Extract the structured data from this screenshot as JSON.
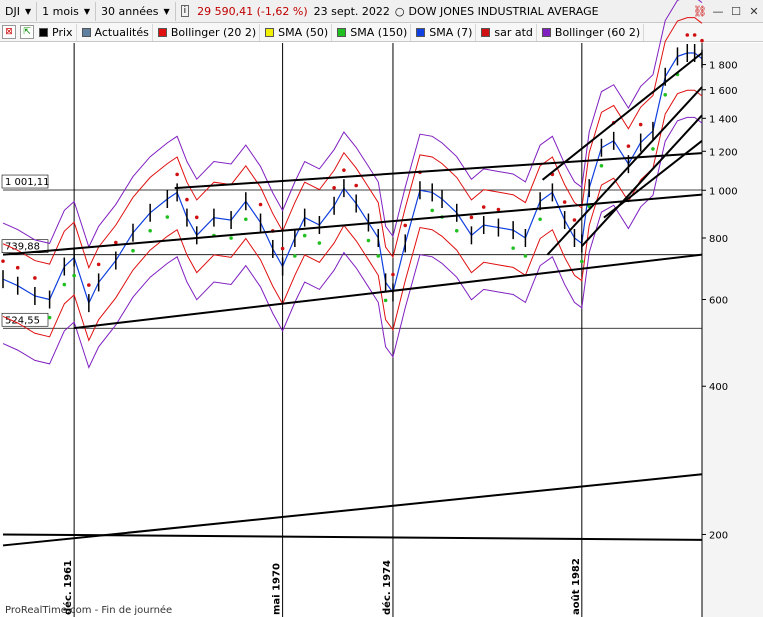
{
  "toolbar": {
    "symbol": "DJI",
    "period": "1 mois",
    "range": "30 années",
    "quote": "29 590,41 (-1,62 %)",
    "date": "23 sept. 2022",
    "instrument": "DOW JONES INDUSTRIAL AVERAGE",
    "colors": {
      "quote": "#c00000"
    }
  },
  "indicators": [
    {
      "label": "Prix",
      "color": "#000000"
    },
    {
      "label": "Actualités",
      "color": "#6080a0"
    },
    {
      "label": "Bollinger (20 2)",
      "color": "#e01010"
    },
    {
      "label": "SMA (50)",
      "color": "#f0f000"
    },
    {
      "label": "SMA (150)",
      "color": "#20c020"
    },
    {
      "label": "SMA (7)",
      "color": "#1040e0"
    },
    {
      "label": "sar atd",
      "color": "#d01010"
    },
    {
      "label": "Bollinger (60 2)",
      "color": "#8020c0"
    }
  ],
  "footer": "ProRealTime.com - Fin de journée",
  "chart_data": {
    "type": "line",
    "y_scale": "log",
    "ylim": [
      180,
      1900
    ],
    "y_ticks": [
      200,
      400,
      600,
      800,
      1000,
      1200,
      1400,
      1600,
      1800
    ],
    "y_tick_labels": [
      "200",
      "400",
      "600",
      "800",
      "1 000",
      "1 200",
      "1 400",
      "1 600",
      "1 800"
    ],
    "horizontal_levels": [
      {
        "value": 1001.11,
        "label": "1 001,11"
      },
      {
        "value": 739.88,
        "label": "739,88"
      },
      {
        "value": 524.55,
        "label": "524,55"
      }
    ],
    "x_markers": [
      {
        "label": "déc. 1961",
        "year": 1961.9
      },
      {
        "label": "mai 1970",
        "year": 1970.4
      },
      {
        "label": "déc. 1974",
        "year": 1974.9
      },
      {
        "label": "août 1982",
        "year": 1982.6
      }
    ],
    "xlim": [
      1959,
      1987.5
    ],
    "series": [
      {
        "name": "Prix",
        "color": "#000000",
        "x": [
          1959.0,
          1959.6,
          1960.3,
          1960.9,
          1961.5,
          1961.9,
          1962.5,
          1962.9,
          1963.6,
          1964.3,
          1965.0,
          1965.7,
          1966.1,
          1966.5,
          1966.9,
          1967.6,
          1968.3,
          1968.9,
          1969.5,
          1970.0,
          1970.4,
          1970.9,
          1971.3,
          1971.9,
          1972.5,
          1972.9,
          1973.4,
          1973.9,
          1974.3,
          1974.6,
          1974.9,
          1975.4,
          1976.0,
          1976.5,
          1976.9,
          1977.5,
          1978.1,
          1978.6,
          1979.2,
          1979.8,
          1980.3,
          1980.9,
          1981.4,
          1981.9,
          1982.3,
          1982.6,
          1982.9,
          1983.4,
          1983.9,
          1984.5,
          1985.0,
          1985.5,
          1986.0,
          1986.5,
          1986.9,
          1987.2,
          1987.5
        ],
        "y": [
          660,
          640,
          610,
          600,
          700,
          730,
          590,
          650,
          720,
          820,
          900,
          960,
          990,
          880,
          810,
          880,
          870,
          950,
          860,
          760,
          700,
          800,
          880,
          850,
          930,
          1010,
          940,
          860,
          800,
          650,
          620,
          780,
          1000,
          990,
          960,
          900,
          810,
          850,
          840,
          830,
          800,
          950,
          990,
          870,
          800,
          780,
          1010,
          1220,
          1260,
          1130,
          1250,
          1320,
          1700,
          1870,
          1900,
          1900,
          1850
        ]
      }
    ],
    "trendlines": 11
  }
}
